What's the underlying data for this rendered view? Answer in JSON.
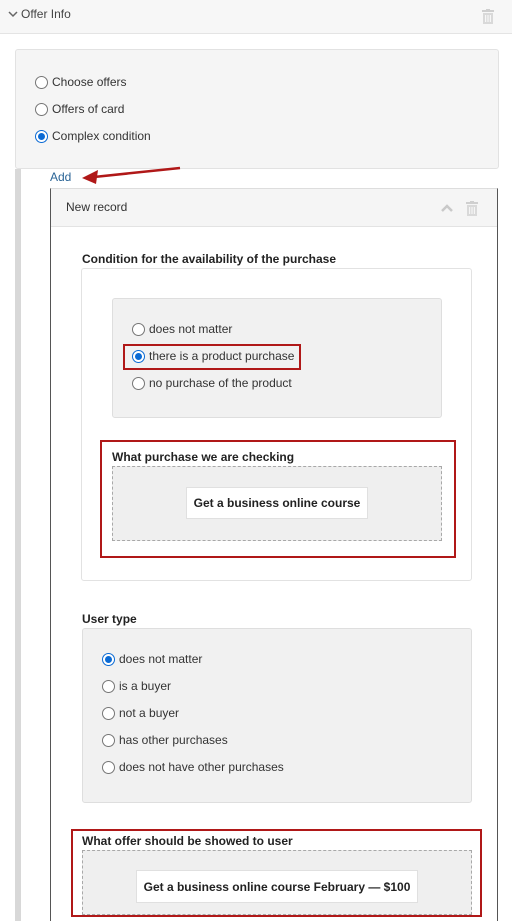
{
  "header": {
    "title": "Offer Info"
  },
  "offer_type": {
    "options": [
      "Choose offers",
      "Offers of card",
      "Complex condition"
    ],
    "selected_index": 2
  },
  "add_label": "Add",
  "record": {
    "title": "New record",
    "purchase_condition": {
      "label": "Condition for the availability of the purchase",
      "options": [
        "does not matter",
        "there is a product purchase",
        "no purchase of the product"
      ],
      "selected_index": 1
    },
    "purchase_check": {
      "label": "What purchase we are checking",
      "product": "Get a business online course"
    },
    "user_type": {
      "label": "User type",
      "options": [
        "does not matter",
        "is a buyer",
        "not a buyer",
        "has other purchases",
        "does not have other purchases"
      ],
      "selected_index": 0
    },
    "offer_shown": {
      "label": "What offer should be showed to user",
      "offer": "Get a business online course February — $100"
    }
  },
  "colors": {
    "accent_red": "#b01818",
    "radio_blue": "#0a6ad4",
    "link_blue": "#2a6496"
  },
  "icons": [
    "chevron-down-icon",
    "trash-icon",
    "caret-up-icon",
    "arrow-icon"
  ]
}
